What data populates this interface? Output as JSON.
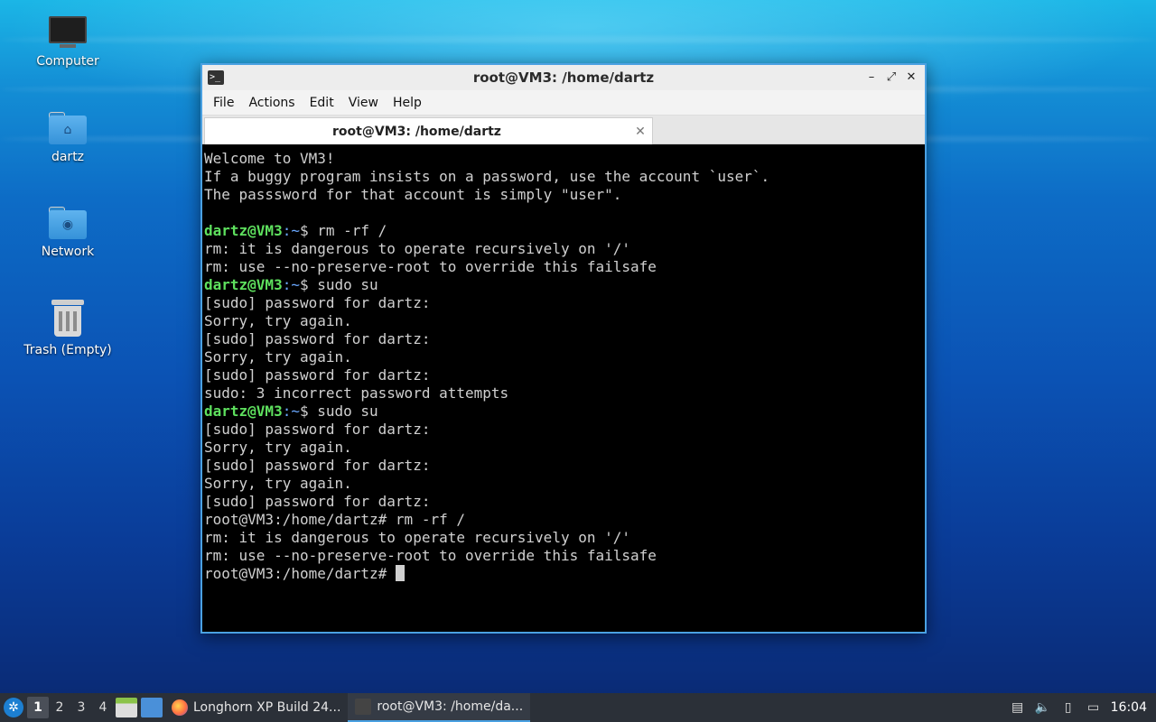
{
  "desktop": {
    "icons": [
      {
        "label": "Computer",
        "icon": "monitor-icon"
      },
      {
        "label": "dartz",
        "icon": "home-folder-icon"
      },
      {
        "label": "Network",
        "icon": "network-folder-icon"
      },
      {
        "label": "Trash (Empty)",
        "icon": "trash-icon"
      }
    ]
  },
  "window": {
    "title": "root@VM3: /home/dartz",
    "menu": [
      "File",
      "Actions",
      "Edit",
      "View",
      "Help"
    ],
    "tab_label": "root@VM3: /home/dartz",
    "terminal": {
      "prompt_user": "dartz@VM3",
      "prompt_path": ":~",
      "lines": [
        {
          "text": "Welcome to VM3!"
        },
        {
          "text": "If a buggy program insists on a password, use the account `user`."
        },
        {
          "text": "The passsword for that account is simply \"user\"."
        },
        {
          "text": ""
        },
        {
          "prompt": true,
          "cmd": "$ rm -rf /"
        },
        {
          "text": "rm: it is dangerous to operate recursively on '/'"
        },
        {
          "text": "rm: use --no-preserve-root to override this failsafe"
        },
        {
          "prompt": true,
          "cmd": "$ sudo su"
        },
        {
          "text": "[sudo] password for dartz:"
        },
        {
          "text": "Sorry, try again."
        },
        {
          "text": "[sudo] password for dartz:"
        },
        {
          "text": "Sorry, try again."
        },
        {
          "text": "[sudo] password for dartz:"
        },
        {
          "text": "sudo: 3 incorrect password attempts"
        },
        {
          "prompt": true,
          "cmd": "$ sudo su"
        },
        {
          "text": "[sudo] password for dartz:"
        },
        {
          "text": "Sorry, try again."
        },
        {
          "text": "[sudo] password for dartz:"
        },
        {
          "text": "Sorry, try again."
        },
        {
          "text": "[sudo] password for dartz:"
        },
        {
          "text": "root@VM3:/home/dartz# rm -rf /"
        },
        {
          "text": "rm: it is dangerous to operate recursively on '/'"
        },
        {
          "text": "rm: use --no-preserve-root to override this failsafe"
        },
        {
          "text": "root@VM3:/home/dartz# ",
          "cursor": true
        }
      ]
    }
  },
  "taskbar": {
    "workspaces": [
      "1",
      "2",
      "3",
      "4"
    ],
    "active_workspace": "1",
    "tasks": [
      {
        "label": "Longhorn XP Build 24...",
        "icon": "firefox-icon"
      },
      {
        "label": "root@VM3: /home/da...",
        "icon": "terminal-icon"
      }
    ],
    "clock": "16:04"
  }
}
